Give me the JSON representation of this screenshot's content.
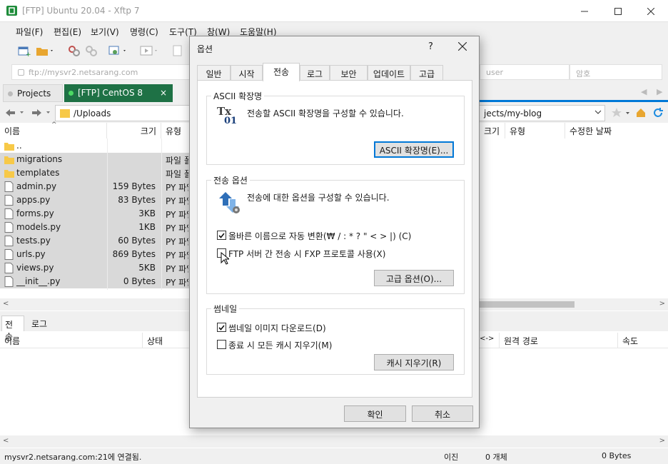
{
  "window": {
    "title": "[FTP] Ubuntu 20.04 - Xftp 7"
  },
  "menu": [
    "파일(F)",
    "편집(E)",
    "보기(V)",
    "명령(C)",
    "도구(T)",
    "창(W)",
    "도움말(H)"
  ],
  "address": {
    "host": "ftp://mysvr2.netsarang.com",
    "user": "user",
    "password": "암호"
  },
  "session_tabs": {
    "projects": "Projects",
    "centos": "[FTP] CentOS 8"
  },
  "left": {
    "path": "/Uploads",
    "columns": [
      "이름",
      "크기",
      "유형"
    ],
    "rows": [
      {
        "name": "..",
        "size": "",
        "type": ""
      },
      {
        "name": "migrations",
        "size": "",
        "type": "파일 폴더"
      },
      {
        "name": "templates",
        "size": "",
        "type": "파일 폴더"
      },
      {
        "name": "admin.py",
        "size": "159 Bytes",
        "type": "PY 파일"
      },
      {
        "name": "apps.py",
        "size": "83 Bytes",
        "type": "PY 파일"
      },
      {
        "name": "forms.py",
        "size": "3KB",
        "type": "PY 파일"
      },
      {
        "name": "models.py",
        "size": "1KB",
        "type": "PY 파일"
      },
      {
        "name": "tests.py",
        "size": "60 Bytes",
        "type": "PY 파일"
      },
      {
        "name": "urls.py",
        "size": "869 Bytes",
        "type": "PY 파일"
      },
      {
        "name": "views.py",
        "size": "5KB",
        "type": "PY 파일"
      },
      {
        "name": "__init__.py",
        "size": "0 Bytes",
        "type": "PY 파일"
      }
    ]
  },
  "right": {
    "path": "jects/my-blog",
    "columns": [
      "크기",
      "유형",
      "수정한 날짜"
    ]
  },
  "bottom": {
    "tabs": [
      "전송",
      "로그"
    ],
    "columns": [
      "이름",
      "상태",
      "<->",
      "원격 경로",
      "속도"
    ]
  },
  "status": {
    "connection": "mysvr2.netsarang.com:21에 연결됨.",
    "binary": "이진",
    "objects": "0 개체",
    "bytes": "0 Bytes"
  },
  "dialog": {
    "title": "옵션",
    "help": "?",
    "tabs": [
      "일반",
      "시작",
      "전송",
      "로그",
      "보안",
      "업데이트",
      "고급"
    ],
    "active_tab": "전송",
    "ascii": {
      "label": "ASCII 확장명",
      "desc": "전송할 ASCII 확장명을 구성할 수 있습니다.",
      "button": "ASCII 확장명(E)...",
      "icon_text_top": "Tx",
      "icon_text_bottom": "01"
    },
    "transfer": {
      "label": "전송 옵션",
      "desc": "전송에 대한 옵션을 구성할 수 있습니다.",
      "opt_rename": "올바른 이름으로 자동 변환(₩ / : * ? \" < > |) (C)",
      "opt_rename_checked": true,
      "opt_fxp": "FTP 서버 간 전송 시 FXP 프로토콜 사용(X)",
      "opt_fxp_checked": false,
      "button": "고급 옵션(O)..."
    },
    "thumb": {
      "label": "썸네일",
      "opt_download": "썸네일 이미지 다운로드(D)",
      "opt_download_checked": true,
      "opt_clear": "종료 시 모든 캐시 지우기(M)",
      "opt_clear_checked": false,
      "button": "캐시 지우기(R)"
    },
    "ok": "확인",
    "cancel": "취소"
  },
  "colors": {
    "accent": "#0078d7",
    "folder": "#f7c948",
    "selection": "#d9d9d9",
    "tab_active": "#1e7145"
  }
}
